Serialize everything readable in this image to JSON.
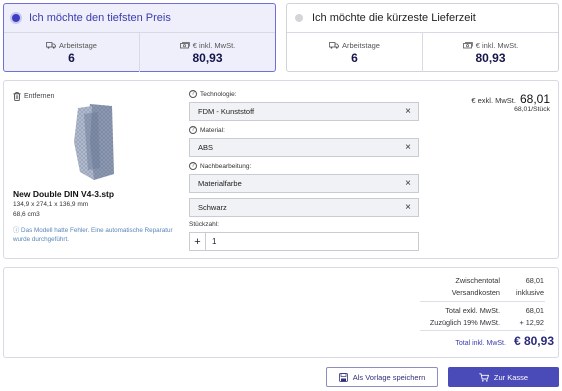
{
  "options": [
    {
      "title": "Ich möchte den tiefsten Preis",
      "days_label": "Arbeitstage",
      "days": "6",
      "price_label": "€ inkl. MwSt.",
      "price": "80,93"
    },
    {
      "title": "Ich möchte die kürzeste Lieferzeit",
      "days_label": "Arbeitstage",
      "days": "6",
      "price_label": "€ inkl. MwSt.",
      "price": "80,93"
    }
  ],
  "item": {
    "remove_label": "Entfernen",
    "filename": "New Double DIN V4-3.stp",
    "dimensions": "134,9 x 274,1 x 136,9 mm",
    "volume": "68,6 cm3",
    "note": "Das Modell hatte Fehler. Eine automatische Reparatur wurde durchgeführt.",
    "technology_label": "Technologie:",
    "technology": "FDM - Kunststoff",
    "material_label": "Material:",
    "material": "ABS",
    "finishing_label": "Nachbearbeitung:",
    "finishing_1": "Materialfarbe",
    "finishing_2": "Schwarz",
    "quantity_label": "Stückzahl:",
    "quantity": "1",
    "price_label": "€ exkl. MwSt.",
    "price": "68,01",
    "unit_price": "68,01/Stück"
  },
  "totals": {
    "subtotal_label": "Zwischentotal",
    "subtotal": "68,01",
    "shipping_label": "Versandkosten",
    "shipping": "inklusive",
    "net_label": "Total exkl. MwSt.",
    "net": "68,01",
    "vat_label": "Zuzüglich 19% MwSt.",
    "vat": "+ 12,92",
    "gross_label": "Total inkl. MwSt.",
    "gross": "€ 80,93"
  },
  "buttons": {
    "save": "Als Vorlage speichern",
    "checkout": "Zur Kasse"
  },
  "colors": {
    "accent": "#4a4ab8",
    "selected_bg": "#eeeffa",
    "note": "#5a86b8"
  }
}
